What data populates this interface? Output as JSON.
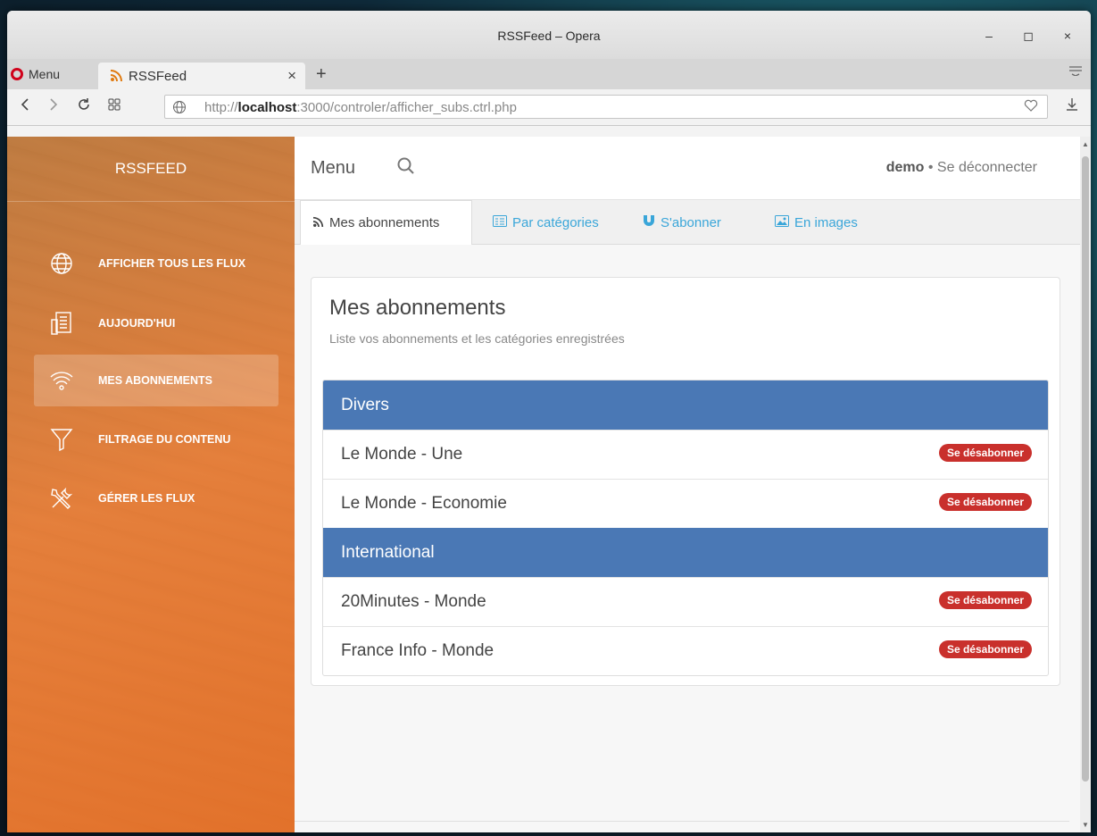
{
  "window": {
    "title": "RSSFeed – Opera",
    "min_glyph": "‒",
    "max_glyph": "◻",
    "close_glyph": "×"
  },
  "browser": {
    "menu_label": "Menu",
    "tab_title": "RSSFeed",
    "tab_close": "×",
    "new_tab": "+",
    "url_prefix": "http://",
    "url_host": "localhost",
    "url_rest": ":3000/controler/afficher_subs.ctrl.php"
  },
  "sidebar": {
    "brand": "RSSFEED",
    "items": [
      {
        "label": "AFFICHER TOUS LES FLUX",
        "icon": "globe-icon"
      },
      {
        "label": "AUJOURD'HUI",
        "icon": "newspaper-icon"
      },
      {
        "label": "MES ABONNEMENTS",
        "icon": "wifi-icon",
        "active": true
      },
      {
        "label": "FILTRAGE DU CONTENU",
        "icon": "filter-icon"
      },
      {
        "label": "GÉRER LES FLUX",
        "icon": "tools-icon"
      }
    ]
  },
  "topbar": {
    "menu": "Menu",
    "username": "demo",
    "separator": " • ",
    "logout": "Se déconnecter"
  },
  "tabs": [
    {
      "label": "Mes abonnements",
      "icon": "rss-icon",
      "active": true
    },
    {
      "label": "Par catégories",
      "icon": "list-icon"
    },
    {
      "label": "S'abonner",
      "icon": "magnet-icon"
    },
    {
      "label": "En images",
      "icon": "image-icon"
    }
  ],
  "panel": {
    "title": "Mes abonnements",
    "subtitle": "Liste vos abonnements et les catégories enregistrées",
    "unsubscribe_label": "Se désabonner",
    "categories": [
      {
        "name": "Divers",
        "feeds": [
          "Le Monde - Une",
          "Le Monde - Economie"
        ]
      },
      {
        "name": "International",
        "feeds": [
          "20Minutes - Monde",
          "France Info - Monde"
        ]
      }
    ]
  },
  "colors": {
    "accent_blue": "#4a78b5",
    "badge_red": "#c9302c",
    "link_blue": "#3aa6d9",
    "sidebar_orange": "#e8792f"
  }
}
